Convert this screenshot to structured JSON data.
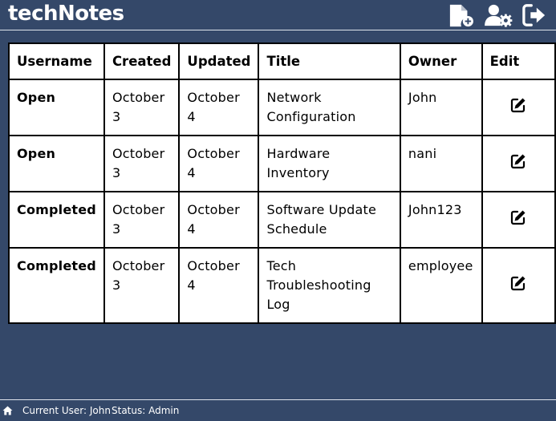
{
  "app": {
    "brand": "techNotes"
  },
  "header": {
    "nav_icons": [
      "new-note-icon",
      "user-settings-icon",
      "logout-icon"
    ]
  },
  "table": {
    "headers": [
      "Username",
      "Created",
      "Updated",
      "Title",
      "Owner",
      "Edit"
    ],
    "rows": [
      {
        "status": "Open",
        "created": "October 3",
        "updated": "October 4",
        "title": "Network Configuration",
        "owner": "John"
      },
      {
        "status": "Open",
        "created": "October 3",
        "updated": "October 4",
        "title": "Hardware Inventory",
        "owner": "nani"
      },
      {
        "status": "Completed",
        "created": "October 3",
        "updated": "October 4",
        "title": "Software Update Schedule",
        "owner": "John123"
      },
      {
        "status": "Completed",
        "created": "October 3",
        "updated": "October 4",
        "title": "Tech Troubleshooting Log",
        "owner": "employee"
      }
    ]
  },
  "footer": {
    "current_user": "Current User: John",
    "status": "Status: Admin"
  },
  "colors": {
    "background": "#344869",
    "open": "#b22a2a",
    "completed": "#33c13c"
  }
}
